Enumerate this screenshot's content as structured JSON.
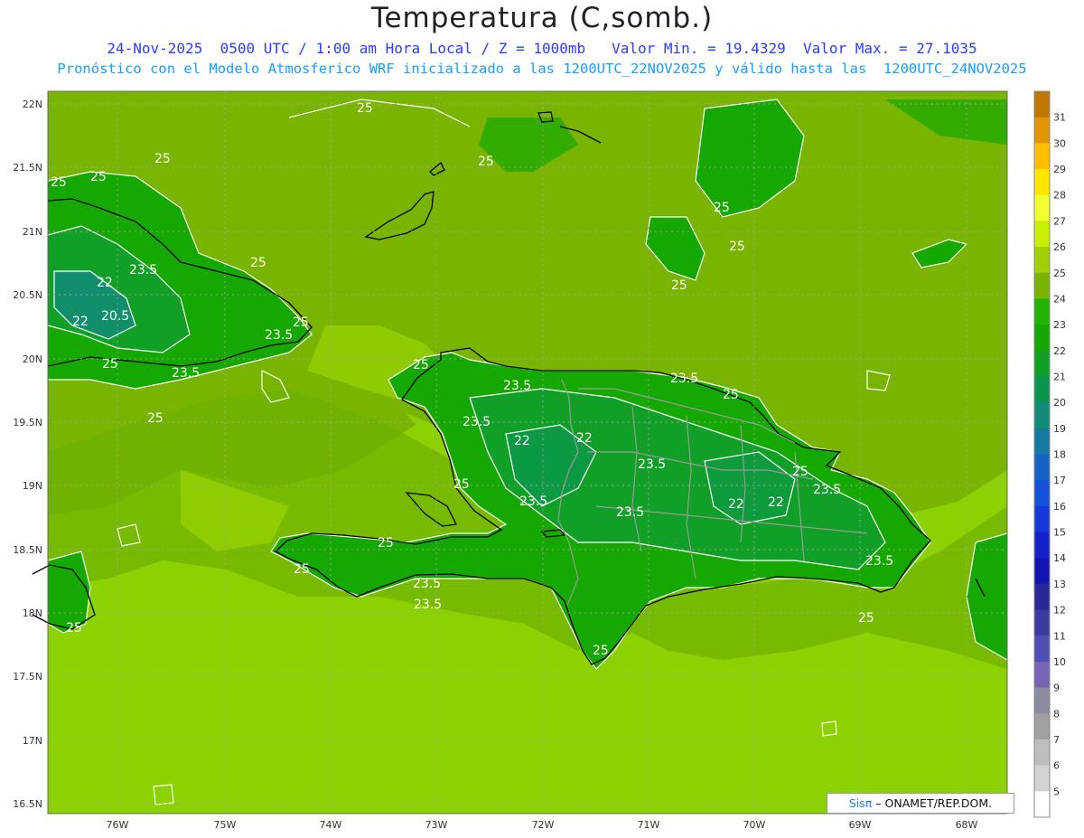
{
  "title": "Temperatura (C,somb.)",
  "subtitle_line1": "24-Nov-2025  0500 UTC / 1:00 am Hora Local / Z = 1000mb   Valor Min. = 19.4329  Valor Max. = 27.1035",
  "subtitle_line2": "Pronóstico con el Modelo Atmosferico WRF inicializado a las 1200UTC_22NOV2025 y válido hasta las  1200UTC_24NOV2025",
  "credit": {
    "logo": "Sisπ",
    "text": "– ONAMET/REP.DOM."
  },
  "colorbar": {
    "labels": [
      "31",
      "30",
      "29",
      "28",
      "27",
      "26",
      "25",
      "24",
      "23",
      "22",
      "21",
      "20",
      "19",
      "18",
      "17",
      "16",
      "15",
      "14",
      "13",
      "12",
      "11",
      "10",
      "9",
      "8",
      "7",
      "6",
      "5"
    ],
    "colors": [
      "#c07800",
      "#e09600",
      "#ffbe00",
      "#ffe600",
      "#f0ff30",
      "#c8f000",
      "#a0d000",
      "#78b400",
      "#20b400",
      "#14a800",
      "#10a028",
      "#0a9650",
      "#128c78",
      "#1478a0",
      "#1464c8",
      "#1450dc",
      "#1438dc",
      "#1420cc",
      "#1414b4",
      "#282896",
      "#3c3ca0",
      "#5050b4",
      "#7864b4",
      "#8c8ca0",
      "#a0a0a0",
      "#bebebe",
      "#d2d2d2",
      "#ffffff"
    ]
  },
  "axes": {
    "lat_labels": [
      "22N",
      "21.5N",
      "21N",
      "20.5N",
      "20N",
      "19.5N",
      "19N",
      "18.5N",
      "18N",
      "17.5N",
      "17N",
      "16.5N"
    ],
    "lon_labels": [
      "76W",
      "75W",
      "74W",
      "73W",
      "72W",
      "71W",
      "70W",
      "69W",
      "68W"
    ]
  },
  "contour_labels": [
    "25",
    "25",
    "25",
    "25",
    "25",
    "25",
    "25",
    "25",
    "25",
    "25",
    "25",
    "25",
    "25",
    "25",
    "25",
    "25",
    "25",
    "25",
    "25",
    "25",
    "23.5",
    "23.5",
    "23.5",
    "23.5",
    "23.5",
    "23.5",
    "23.5",
    "23.5",
    "23.5",
    "23.5",
    "23.5",
    "23.5",
    "23.5",
    "22",
    "22",
    "22",
    "22",
    "22",
    "22",
    "20.5"
  ],
  "field": {
    "min": 19.4329,
    "max": 27.1035,
    "units": "C",
    "level": "1000mb"
  }
}
